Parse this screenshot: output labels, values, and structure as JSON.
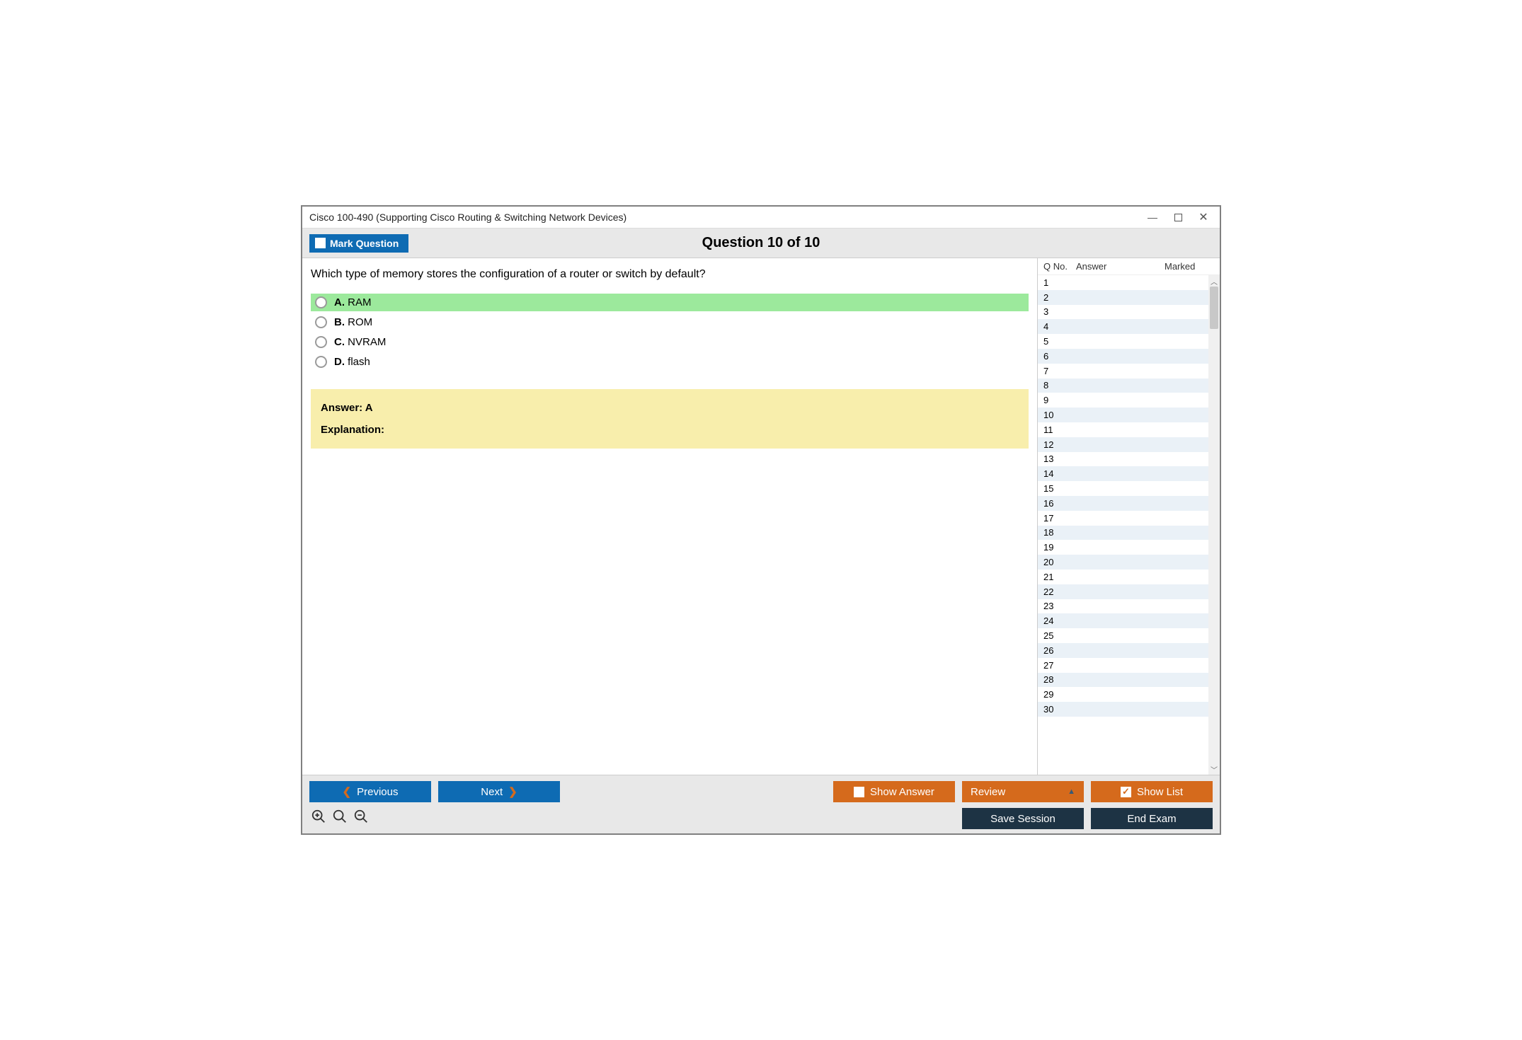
{
  "window": {
    "title": "Cisco 100-490 (Supporting Cisco Routing & Switching Network Devices)"
  },
  "header": {
    "mark_label": "Mark Question",
    "counter": "Question 10 of 10"
  },
  "question": {
    "text": "Which type of memory stores the configuration of a router or switch by default?",
    "choices": [
      {
        "letter": "A.",
        "text": "RAM",
        "correct": true
      },
      {
        "letter": "B.",
        "text": "ROM",
        "correct": false
      },
      {
        "letter": "C.",
        "text": "NVRAM",
        "correct": false
      },
      {
        "letter": "D.",
        "text": "flash",
        "correct": false
      }
    ],
    "answer_label": "Answer: A",
    "explanation_label": "Explanation:"
  },
  "sidebar": {
    "headers": {
      "qno": "Q No.",
      "answer": "Answer",
      "marked": "Marked"
    },
    "rows": [
      {
        "n": "1"
      },
      {
        "n": "2"
      },
      {
        "n": "3"
      },
      {
        "n": "4"
      },
      {
        "n": "5"
      },
      {
        "n": "6"
      },
      {
        "n": "7"
      },
      {
        "n": "8"
      },
      {
        "n": "9"
      },
      {
        "n": "10"
      },
      {
        "n": "11"
      },
      {
        "n": "12"
      },
      {
        "n": "13"
      },
      {
        "n": "14"
      },
      {
        "n": "15"
      },
      {
        "n": "16"
      },
      {
        "n": "17"
      },
      {
        "n": "18"
      },
      {
        "n": "19"
      },
      {
        "n": "20"
      },
      {
        "n": "21"
      },
      {
        "n": "22"
      },
      {
        "n": "23"
      },
      {
        "n": "24"
      },
      {
        "n": "25"
      },
      {
        "n": "26"
      },
      {
        "n": "27"
      },
      {
        "n": "28"
      },
      {
        "n": "29"
      },
      {
        "n": "30"
      }
    ]
  },
  "footer": {
    "previous": "Previous",
    "next": "Next",
    "show_answer": "Show Answer",
    "review": "Review",
    "show_list": "Show List",
    "save_session": "Save Session",
    "end_exam": "End Exam"
  }
}
